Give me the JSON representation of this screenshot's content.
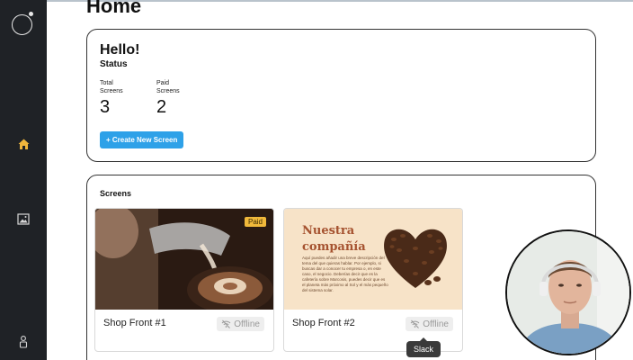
{
  "sidebar": {
    "icons": [
      "logo-icon",
      "home-icon",
      "image-icon",
      "user-icon"
    ],
    "active_color": "#f0b63c"
  },
  "page": {
    "title": "Home"
  },
  "status_card": {
    "greeting": "Hello!",
    "status_label": "Status",
    "stats": [
      {
        "label": "Total Screens",
        "value": "3"
      },
      {
        "label": "Paid Screens",
        "value": "2"
      }
    ],
    "create_button_label": "+ Create New Screen"
  },
  "screens_card": {
    "title": "Screens",
    "screens": [
      {
        "name": "Shop Front #1",
        "status": "Offline",
        "badge": "Paid"
      },
      {
        "name": "Shop Front #2",
        "status": "Offline"
      }
    ],
    "preview_2": {
      "heading_line_1": "Nuestra",
      "heading_line_2": "compañía",
      "body": "Aquí puedes añadir una breve descripción del tema del que quieras hablar. Por ejemplo, si buscas dar a conocer tu empresa o, en este caso, el negocio. Deberías decir que es la cafetería sobre Marcosis, puedes decir que es el planeta más próximo al Sol y el más pequeño del sistema solar."
    }
  },
  "tooltip": {
    "text": "Slack"
  },
  "colors": {
    "accent_blue": "#2ea1e8",
    "sidebar_bg": "#1f2226",
    "paid_badge": "#f1b93b"
  }
}
